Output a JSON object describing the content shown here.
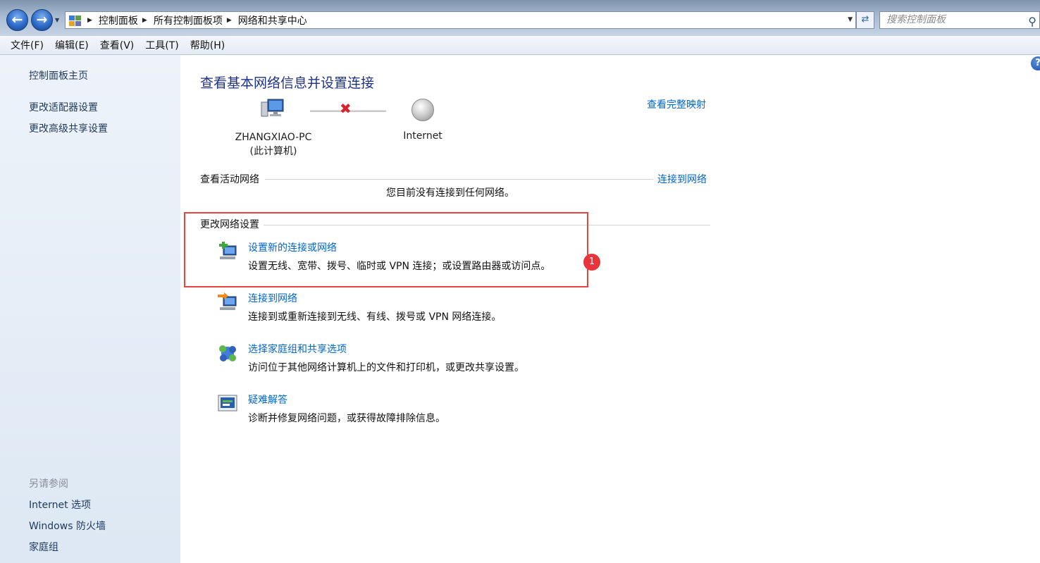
{
  "addressbar": {
    "breadcrumbs": [
      "控制面板",
      "所有控制面板项",
      "网络和共享中心"
    ],
    "search_placeholder": "搜索控制面板"
  },
  "menu": [
    "文件(F)",
    "编辑(E)",
    "查看(V)",
    "工具(T)",
    "帮助(H)"
  ],
  "sidebar": {
    "links": [
      "控制面板主页",
      "更改适配器设置",
      "更改高级共享设置"
    ],
    "see_also_heading": "另请参阅",
    "see_also": [
      "Internet 选项",
      "Windows 防火墙",
      "家庭组"
    ]
  },
  "main": {
    "title": "查看基本网络信息并设置连接",
    "full_map_link": "查看完整映射",
    "computer_name": "ZHANGXIAO-PC",
    "computer_sub": "(此计算机)",
    "internet_label": "Internet",
    "active_networks_heading": "查看活动网络",
    "connect_link": "连接到网络",
    "no_connection_text": "您目前没有连接到任何网络。",
    "change_settings_heading": "更改网络设置",
    "tasks": [
      {
        "link": "设置新的连接或网络",
        "desc": "设置无线、宽带、拨号、临时或 VPN 连接；或设置路由器或访问点。"
      },
      {
        "link": "连接到网络",
        "desc": "连接到或重新连接到无线、有线、拨号或 VPN 网络连接。"
      },
      {
        "link": "选择家庭组和共享选项",
        "desc": "访问位于其他网络计算机上的文件和打印机，或更改共享设置。"
      },
      {
        "link": "疑难解答",
        "desc": "诊断并修复网络问题，或获得故障排除信息。"
      }
    ]
  },
  "annotation": {
    "badge_number": "1",
    "color": "#e8453c"
  }
}
